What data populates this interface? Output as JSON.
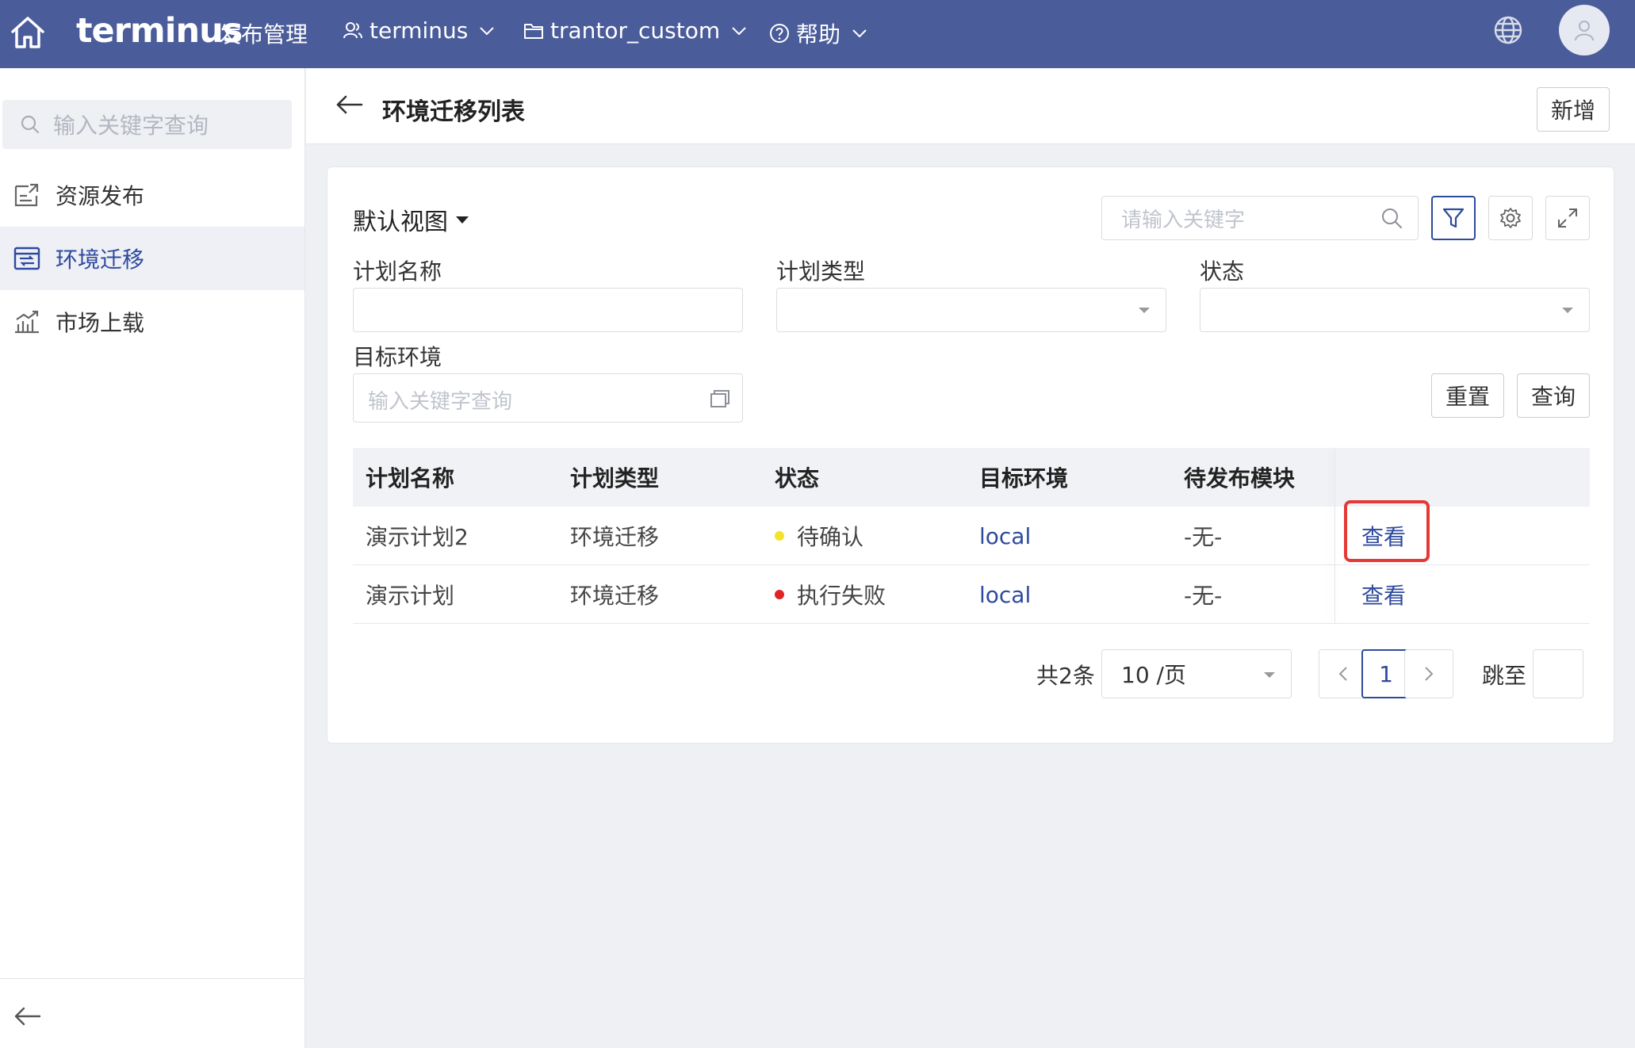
{
  "topbar": {
    "logo": "terminus",
    "app_title": "发布管理",
    "nav": [
      {
        "label": "terminus",
        "icon": "user-icon"
      },
      {
        "label": "trantor_custom",
        "icon": "folder-icon"
      },
      {
        "label": "帮助",
        "icon": "help-icon"
      }
    ]
  },
  "sidebar": {
    "search_placeholder": "输入关键字查询",
    "items": [
      {
        "label": "资源发布",
        "icon": "resource-publish-icon",
        "active": false
      },
      {
        "label": "环境迁移",
        "icon": "env-migration-icon",
        "active": true
      },
      {
        "label": "市场上载",
        "icon": "market-upload-icon",
        "active": false
      }
    ]
  },
  "header": {
    "title": "环境迁移列表",
    "add_label": "新增"
  },
  "filters": {
    "view_label": "默认视图",
    "keyword_placeholder": "请输入关键字",
    "plan_name_label": "计划名称",
    "plan_type_label": "计划类型",
    "status_label": "状态",
    "target_env_label": "目标环境",
    "target_env_placeholder": "输入关键字查询",
    "reset_label": "重置",
    "query_label": "查询"
  },
  "table": {
    "columns": [
      "计划名称",
      "计划类型",
      "状态",
      "目标环境",
      "待发布模块",
      ""
    ],
    "rows": [
      {
        "name": "演示计划2",
        "type": "环境迁移",
        "status": "待确认",
        "status_color": "#f5e32a",
        "target": "local",
        "modules": "-无-",
        "action": "查看"
      },
      {
        "name": "演示计划",
        "type": "环境迁移",
        "status": "执行失败",
        "status_color": "#e02424",
        "target": "local",
        "modules": "-无-",
        "action": "查看"
      }
    ]
  },
  "pagination": {
    "total": "共2条",
    "page_size": "10 /页",
    "current_page": "1",
    "jump_label": "跳至"
  },
  "colors": {
    "topbar": "#4b5c9a",
    "accent": "#2e4a9e",
    "highlight": "#e53935"
  }
}
